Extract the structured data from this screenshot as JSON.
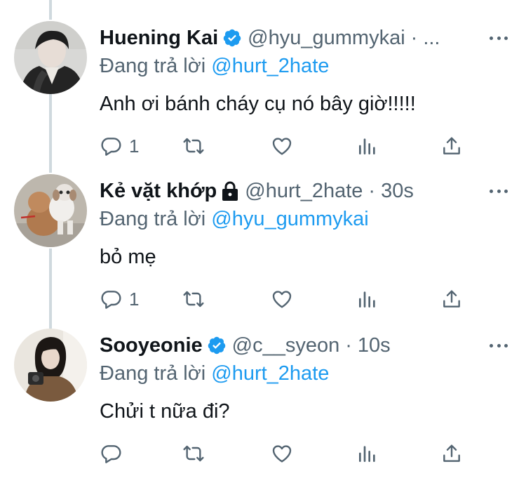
{
  "colors": {
    "text": "#0f1419",
    "muted": "#536471",
    "link": "#1d9bf0",
    "verified": "#1d9bf0",
    "thread_line": "#cfd9de"
  },
  "tweets": [
    {
      "name": "Huening Kai",
      "verified": true,
      "handle": "@hyu_gummykai",
      "separator": "·",
      "time": "",
      "trailing": "...",
      "reply_prefix": "Đang trả lời",
      "reply_to": "@hurt_2hate",
      "text": "Anh ơi bánh cháy cụ nó bây giờ!!!!!",
      "reply_count": "1",
      "avatar_icon": "avatar-photo-icon"
    },
    {
      "name": "Kẻ vặt khớp",
      "verified": false,
      "locked": true,
      "handle": "@hurt_2hate",
      "separator": "·",
      "time": "30s",
      "reply_prefix": "Đang trả lời",
      "reply_to": "@hyu_gummykai",
      "text": "bỏ mẹ",
      "reply_count": "1",
      "avatar_icon": "dog-avatar-icon"
    },
    {
      "name": "Sooyeonie",
      "verified": true,
      "handle": "@c__syeon",
      "separator": "·",
      "time": "10s",
      "reply_prefix": "Đang trả lời",
      "reply_to": "@hurt_2hate",
      "text": "Chửi t nữa đi?",
      "reply_count": "",
      "avatar_icon": "avatar-photo-icon"
    }
  ]
}
